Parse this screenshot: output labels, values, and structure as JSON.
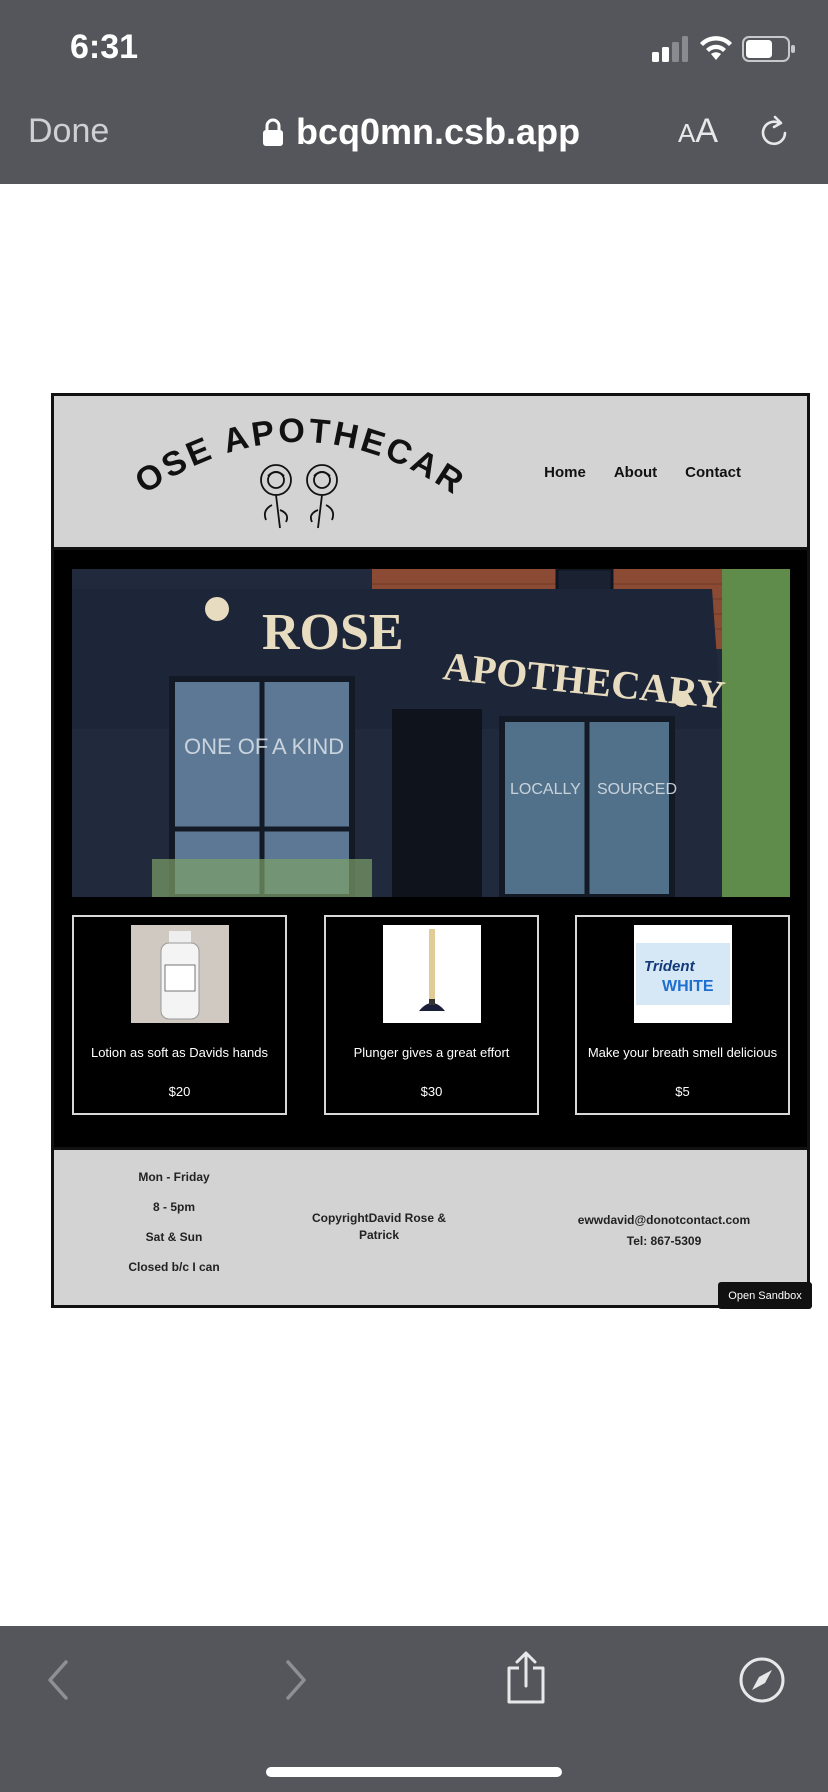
{
  "status_bar": {
    "time": "6:31"
  },
  "browser": {
    "done_label": "Done",
    "url": "bcq0mn.csb.app",
    "text_size_label_small": "A",
    "text_size_label_large": "A"
  },
  "site": {
    "logo_text": "ROSE APOTHECARY",
    "nav": [
      "Home",
      "About",
      "Contact"
    ],
    "hero": {
      "sign_text_1": "ROSE",
      "sign_text_2": "APOTHECARY",
      "window_text_1": "ONE OF",
      "window_text_2": "A KIND",
      "window_text_3": "LOCALLY",
      "window_text_4": "SOURCED"
    },
    "products": [
      {
        "description": "Lotion as soft as Davids hands",
        "price": "$20",
        "image_icon": "lotion-bottle"
      },
      {
        "description": "Plunger gives a great effort",
        "price": "$30",
        "image_icon": "plunger"
      },
      {
        "description": "Make your breath smell delicious",
        "price": "$5",
        "image_icon": "gum-pack",
        "brand_1": "Trident",
        "brand_2": "WHITE"
      }
    ],
    "footer": {
      "hours": [
        "Mon - Friday",
        "8 - 5pm",
        "Sat & Sun",
        "Closed b/c I can"
      ],
      "copyright": "CopyrightDavid Rose & Patrick",
      "email": "ewwdavid@donotcontact.com",
      "phone": "Tel: 867-5309"
    }
  },
  "sandbox_button": "Open Sandbox",
  "colors": {
    "chrome": "#55565b",
    "header_bg": "#d3d3d3",
    "page_bg": "#000000"
  }
}
